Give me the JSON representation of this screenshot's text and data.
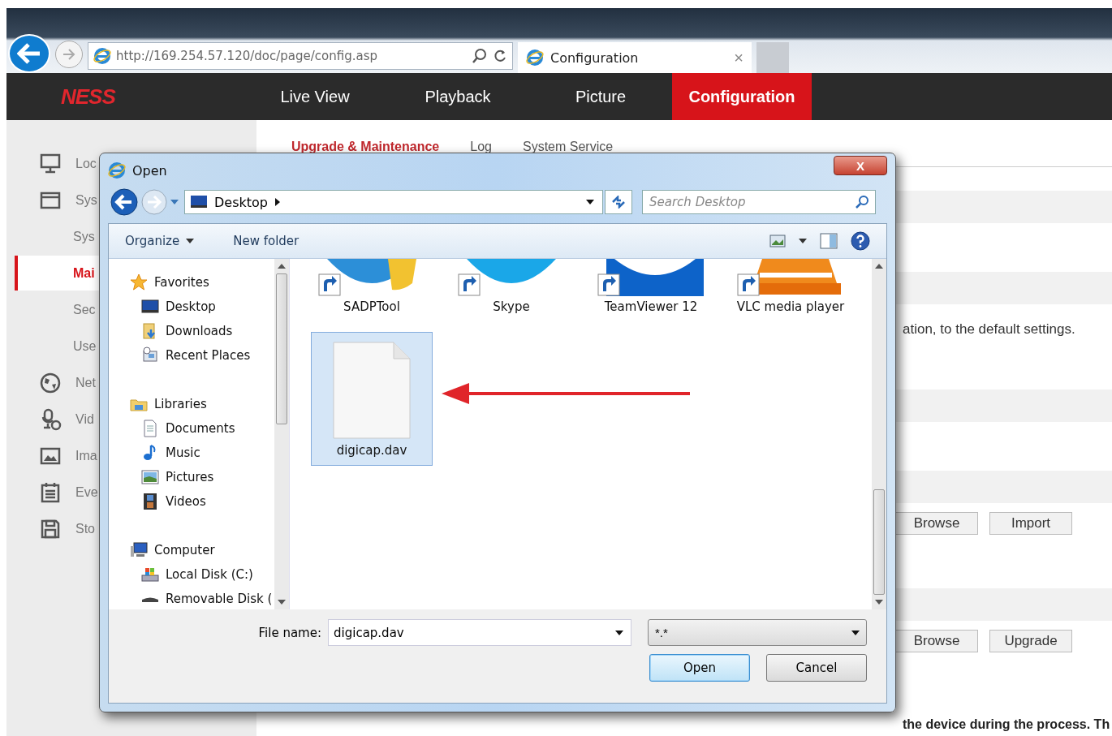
{
  "browser": {
    "address": "http://169.254.57.120/doc/page/config.asp",
    "tab_title": "Configuration",
    "tab_close": "×"
  },
  "app": {
    "logo": "NESS",
    "nav": [
      {
        "label": "Live View",
        "selected": false
      },
      {
        "label": "Playback",
        "selected": false
      },
      {
        "label": "Picture",
        "selected": false
      },
      {
        "label": "Configuration",
        "selected": true
      }
    ]
  },
  "sidebar": [
    {
      "label": "Loc",
      "selected": false
    },
    {
      "label": "Sys",
      "selected": false,
      "children": [
        {
          "label": "Sys",
          "selected": false
        },
        {
          "label": "Mai",
          "selected": true
        },
        {
          "label": "Sec",
          "selected": false
        },
        {
          "label": "Use",
          "selected": false
        }
      ]
    },
    {
      "label": "Net",
      "selected": false
    },
    {
      "label": "Vid",
      "selected": false
    },
    {
      "label": "Ima",
      "selected": false
    },
    {
      "label": "Eve",
      "selected": false
    },
    {
      "label": "Sto",
      "selected": false
    }
  ],
  "content": {
    "tabs": [
      {
        "label": "Upgrade & Maintenance",
        "selected": true
      },
      {
        "label": "Log",
        "selected": false
      },
      {
        "label": "System Service",
        "selected": false
      }
    ],
    "default_text": "ation, to the default settings.",
    "import_buttons": [
      "Browse",
      "Import"
    ],
    "upgrade_buttons": [
      "Browse",
      "Upgrade"
    ],
    "note": "the device during the process. Th"
  },
  "dialog": {
    "title": "Open",
    "close": "X",
    "location": "Desktop",
    "search_placeholder": "Search Desktop",
    "organize": "Organize",
    "new_folder": "New folder",
    "nav_tree": [
      {
        "label": "Favorites",
        "children": [
          {
            "label": "Desktop"
          },
          {
            "label": "Downloads"
          },
          {
            "label": "Recent Places"
          }
        ]
      },
      {
        "label": "Libraries",
        "children": [
          {
            "label": "Documents"
          },
          {
            "label": "Music"
          },
          {
            "label": "Pictures"
          },
          {
            "label": "Videos"
          }
        ]
      },
      {
        "label": "Computer",
        "children": [
          {
            "label": "Local Disk (C:)"
          },
          {
            "label": "Removable Disk ("
          }
        ]
      }
    ],
    "files": [
      {
        "name": "SADPTool",
        "kind": "shortcut",
        "selected": false
      },
      {
        "name": "Skype",
        "kind": "shortcut",
        "selected": false
      },
      {
        "name": "TeamViewer 12",
        "kind": "shortcut",
        "selected": false
      },
      {
        "name": "VLC media player",
        "kind": "shortcut",
        "selected": false
      },
      {
        "name": "digicap.dav",
        "kind": "file",
        "selected": true
      }
    ],
    "file_name_label": "File name:",
    "file_name": "digicap.dav",
    "file_type": "*.*",
    "open": "Open",
    "cancel": "Cancel"
  }
}
